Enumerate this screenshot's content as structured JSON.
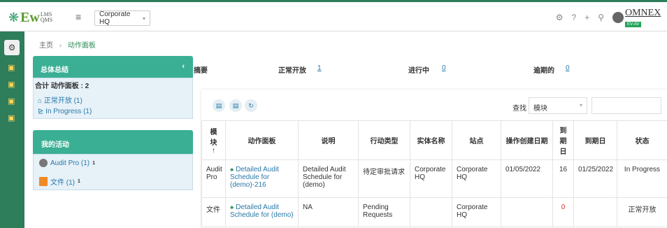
{
  "header": {
    "logo_main": "Ew",
    "logo_top": "LMS",
    "logo_bottom": "QMS",
    "site": "Corporate HQ",
    "brand": "OMNEX",
    "brand_badge": "EV-AV"
  },
  "breadcrumb": {
    "home": "主页",
    "current": "动作面板"
  },
  "summary_panel": {
    "title": "总体总结",
    "total": "合计 动作面板 : 2",
    "items": [
      {
        "label": "正常开放 (1)"
      },
      {
        "label": "In Progress (1)"
      }
    ]
  },
  "activity_panel": {
    "title": "我的活动",
    "items": [
      {
        "label": "Audit Pro (1)",
        "badge": "1"
      },
      {
        "label": "文件 (1)",
        "badge": "1"
      }
    ]
  },
  "strip": {
    "summary_label": "摘要",
    "open_label": "正常开放",
    "open_value": "1",
    "progress_label": "进行中",
    "progress_value": "0",
    "overdue_label": "逾期的",
    "overdue_value": "0"
  },
  "toolbar": {
    "search_label": "查找",
    "module_value": "模块",
    "search_placeholder": ""
  },
  "table": {
    "columns": [
      "模块↑",
      "动作面板",
      "说明",
      "行动类型",
      "实体名称",
      "站点",
      "操作创建日期",
      "到期日",
      "到期日",
      "状态"
    ],
    "col_module": "模\n块\n↑",
    "col_due_days": "到\n期\n日",
    "rows": [
      {
        "module": "Audit Pro",
        "board": "Detailed Audit Schedule for (demo)-216",
        "desc": "Detailed Audit Schedule for (demo)",
        "type": "待定审批请求",
        "entity": "Corporate HQ",
        "site": "Corporate HQ",
        "created": "01/05/2022",
        "days": "16",
        "due": "01/25/2022",
        "status": "In Progress"
      },
      {
        "module": "文件",
        "board": "Detailed Audit Schedule for (demo)",
        "desc": "NA",
        "type": "Pending Requests",
        "entity": "",
        "site": "Corporate HQ",
        "created": "",
        "days": "0",
        "due": "",
        "status": "正常开放"
      }
    ]
  },
  "colors": {
    "brand_green": "#2e7d5b",
    "panel_teal": "#3aaf94",
    "link_blue": "#2979a8",
    "overdue_red": "#d9342b"
  }
}
